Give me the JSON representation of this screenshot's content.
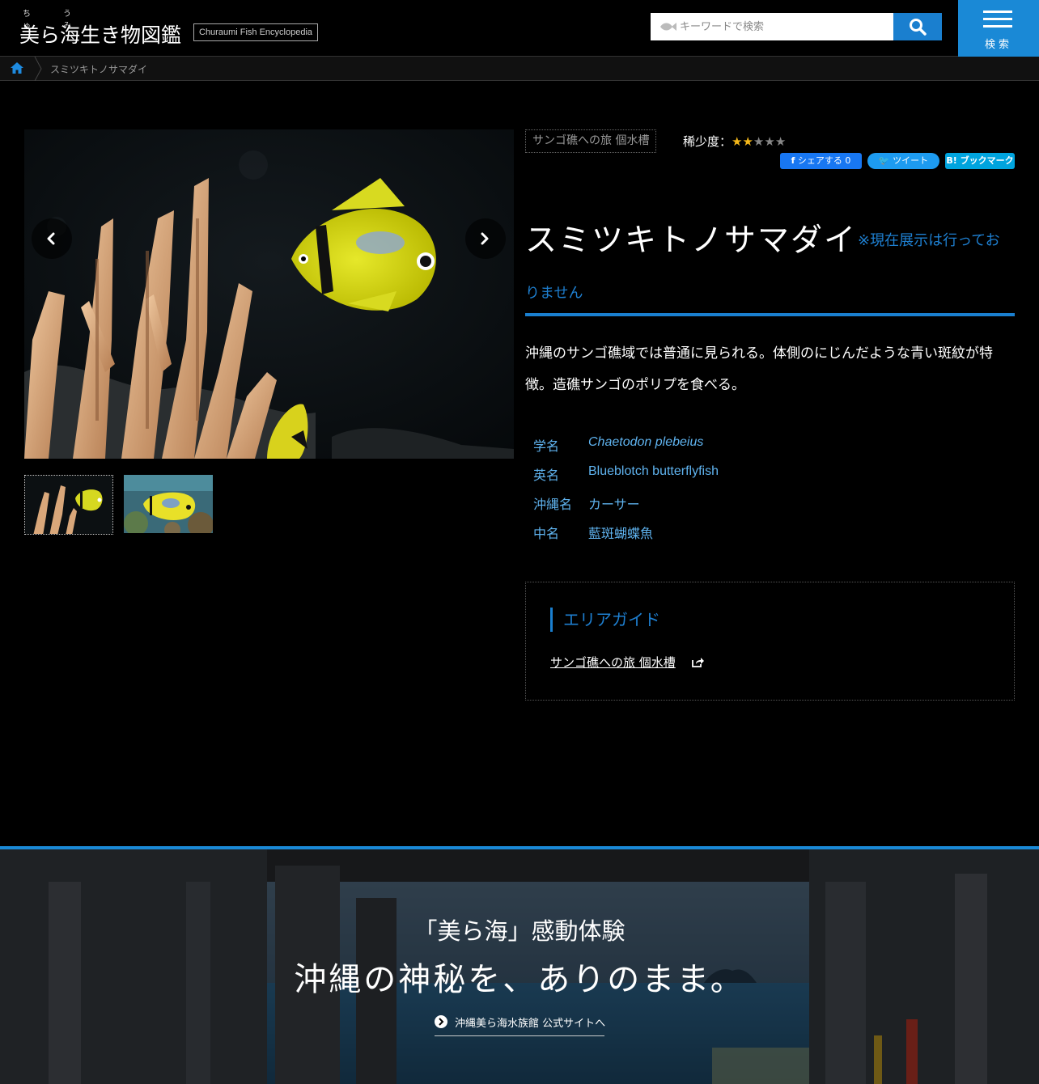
{
  "header": {
    "ruby_1": "ちゅ",
    "ruby_2": "うみ",
    "logo_title": "美ら海生き物図鑑",
    "logo_subtitle": "Churaumi Fish Encyclopedia",
    "search_placeholder": "キーワードで検索",
    "menu_label": "検索",
    "accent_color": "#1a89d6"
  },
  "breadcrumb": {
    "current": "スミツキトノサマダイ"
  },
  "detail": {
    "area_tag": "サンゴ礁への旅 個水槽",
    "rarity_label": "稀少度：",
    "rarity_level": 2,
    "rarity_max": 5,
    "share_facebook": "シェアする 0",
    "share_twitter": "ツイート",
    "share_hatena": "ブックマーク",
    "name": "スミツキトノサマダイ",
    "notice_line1": "※現在展示は行ってお",
    "notice_line2": "りません",
    "description": "沖縄のサンゴ礁域では普通に見られる。体側のにじんだような青い斑紋が特徴。造礁サンゴのポリプを食べる。",
    "info": [
      {
        "key": "学名",
        "value": "Chaetodon plebeius"
      },
      {
        "key": "英名",
        "value": "Blueblotch butterflyfish"
      },
      {
        "key": "沖縄名",
        "value": "カーサー"
      },
      {
        "key": "中名",
        "value": "藍斑蝴蝶魚"
      }
    ]
  },
  "area_guide": {
    "title": "エリアガイド",
    "link": "サンゴ礁への旅 個水槽"
  },
  "banner": {
    "line1": "「美ら海」感動体験",
    "line2": "沖縄の神秘を、ありのまま。",
    "link": "沖縄美ら海水族館 公式サイトへ"
  }
}
